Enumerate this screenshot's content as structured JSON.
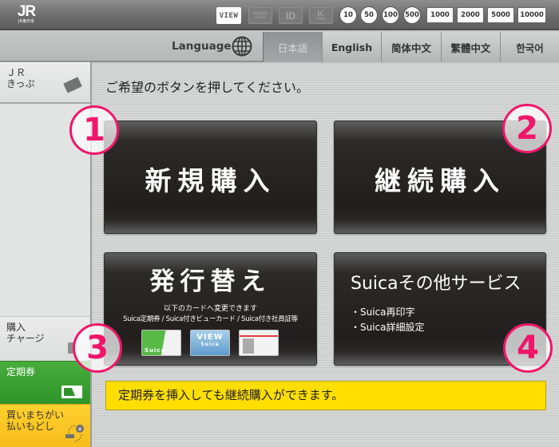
{
  "header": {
    "logo": {
      "mark": "JR",
      "sub": "JR東日本"
    },
    "accepted_media": {
      "cards": [
        {
          "name": "VIEW",
          "label": "VIEW",
          "enabled": true
        },
        {
          "name": "Orange Card",
          "label": "ORANGE CARD",
          "enabled": false
        },
        {
          "name": "Pasmo",
          "label": "ID",
          "enabled": false
        },
        {
          "name": "IC Card",
          "label": "IC",
          "sublabel": "CARD",
          "enabled": false
        }
      ],
      "coins": [
        "10",
        "50",
        "100",
        "500"
      ],
      "bills": [
        "1000",
        "2000",
        "5000",
        "10000"
      ]
    }
  },
  "language_bar": {
    "label": "Language",
    "icon": "globe-icon",
    "tabs": [
      {
        "label": "日本語",
        "active": true
      },
      {
        "label": "English",
        "active": false
      },
      {
        "label": "简体中文",
        "active": false
      },
      {
        "label": "繁體中文",
        "active": false
      },
      {
        "label": "한국어",
        "active": false
      }
    ]
  },
  "sidebar": {
    "items": [
      {
        "line1": "ＪＲ",
        "line2": "きっぷ",
        "icon": "ticket-icon"
      },
      {
        "line1": "購入",
        "line2": "チャージ",
        "icon": "charge-icon"
      },
      {
        "line1": "定期券",
        "line2": "",
        "icon": "commuter-pass-icon",
        "color": "#3a9f33"
      },
      {
        "line1": "買いまちがい",
        "line2": "払いもどし",
        "icon": "refund-icon",
        "color": "#fac624"
      }
    ]
  },
  "main": {
    "instruction": "ご希望のボタンを押してください。",
    "buttons": {
      "new_purchase": "新規購入",
      "continue_purchase": "継続購入",
      "reissue": {
        "title": "発行替え",
        "line1": "以下のカードへ変更できます",
        "line2": "Suica定期券 / Suica付きビューカード / Suica付き社員証等",
        "cards": [
          "Suica",
          "VIEW Suica",
          "社員証"
        ]
      },
      "other_services": {
        "title": "Suicaその他サービス",
        "items": [
          "・Suica再印字",
          "・Suica詳細設定"
        ]
      }
    },
    "notice": "定期券を挿入しても継続購入ができます。",
    "callouts": [
      "1",
      "2",
      "3",
      "4"
    ],
    "callout_color": "#f0166b"
  }
}
